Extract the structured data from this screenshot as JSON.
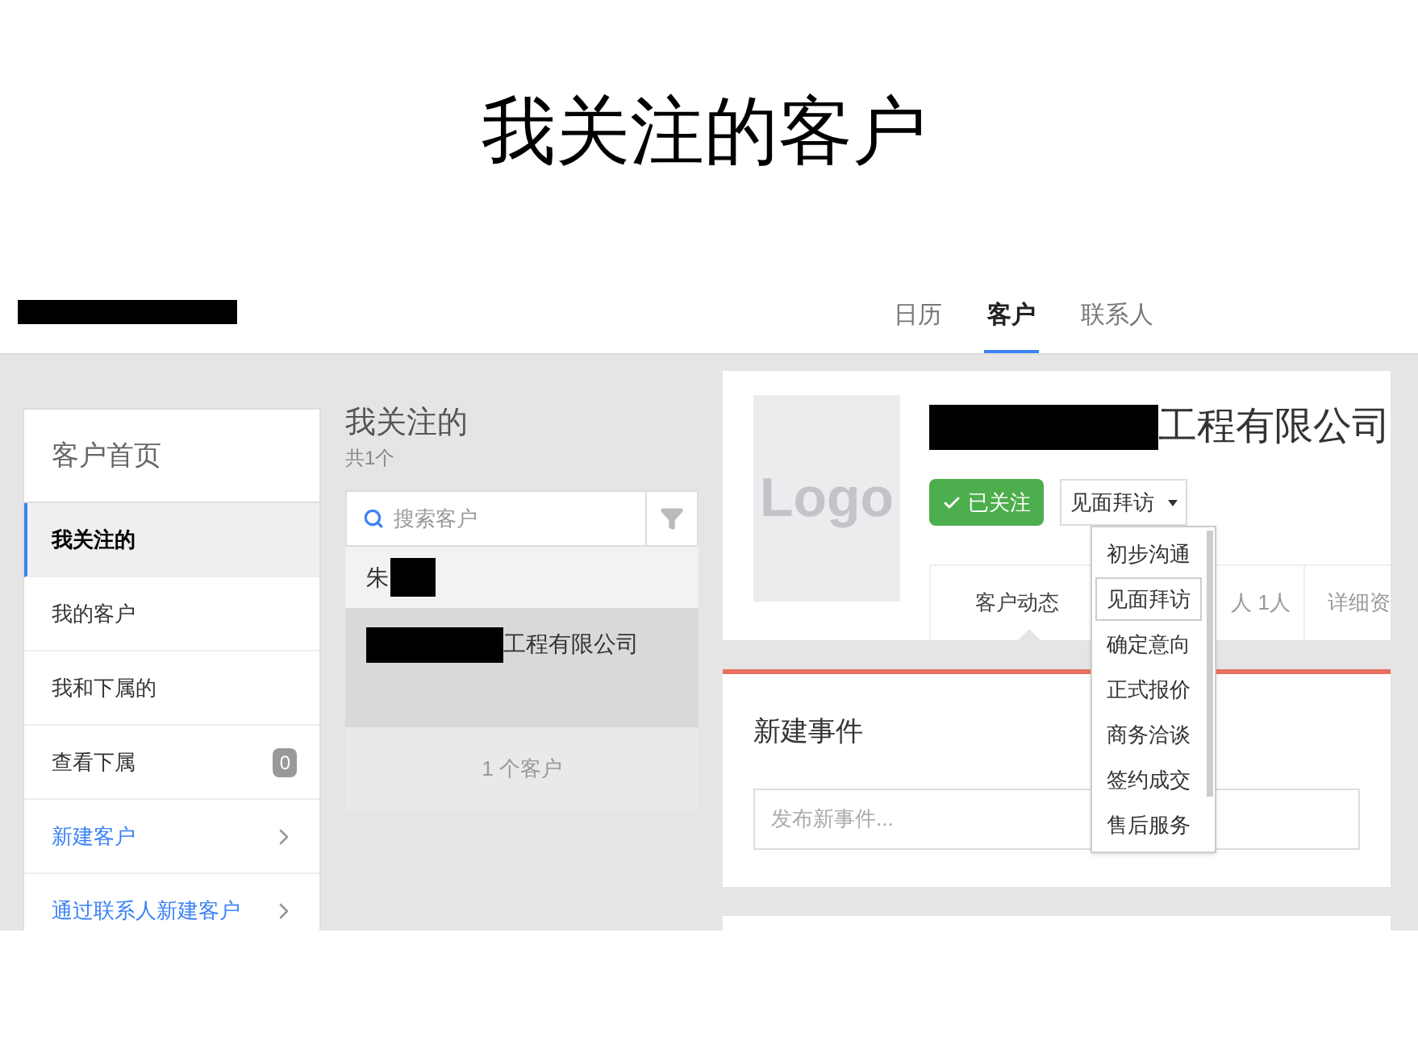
{
  "slide_title": "我关注的客户",
  "nav": {
    "tabs": [
      {
        "label": "日历",
        "selected": false
      },
      {
        "label": "客户",
        "selected": true
      },
      {
        "label": "联系人",
        "selected": false
      }
    ]
  },
  "sidebar": {
    "title": "客户首页",
    "items": [
      {
        "label": "我关注的",
        "kind": "filter",
        "selected": true
      },
      {
        "label": "我的客户",
        "kind": "filter",
        "selected": false
      },
      {
        "label": "我和下属的",
        "kind": "filter",
        "selected": false
      },
      {
        "label": "查看下属",
        "kind": "count",
        "badge": "0",
        "selected": false
      },
      {
        "label": "新建客户",
        "kind": "action",
        "selected": false
      },
      {
        "label": "通过联系人新建客户",
        "kind": "action",
        "selected": false
      }
    ]
  },
  "list": {
    "title": "我关注的",
    "count": "共1个",
    "search": {
      "placeholder": "搜索客户"
    },
    "rows": [
      {
        "text": "朱",
        "kind": "person",
        "redacted": true,
        "selected": false
      },
      {
        "text": "工程有限公司",
        "kind": "company",
        "redacted": true,
        "selected": true
      }
    ],
    "footer": "1 个客户"
  },
  "detail": {
    "logo": "Logo",
    "name": "工程有限公司",
    "follow_button": "已关注",
    "stage": {
      "value": "见面拜访",
      "options": [
        {
          "label": "初步沟通",
          "selected": false
        },
        {
          "label": "见面拜访",
          "selected": true
        },
        {
          "label": "确定意向",
          "selected": false
        },
        {
          "label": "正式报价",
          "selected": false
        },
        {
          "label": "商务洽谈",
          "selected": false
        },
        {
          "label": "签约成交",
          "selected": false
        },
        {
          "label": "售后服务",
          "selected": false
        }
      ]
    },
    "tabs": [
      {
        "label": "客户动态",
        "selected": true
      },
      {
        "label": "人 1人",
        "selected": false
      },
      {
        "label": "详细资",
        "selected": false
      }
    ],
    "event_card": {
      "title": "新建事件",
      "placeholder": "发布新事件..."
    }
  }
}
